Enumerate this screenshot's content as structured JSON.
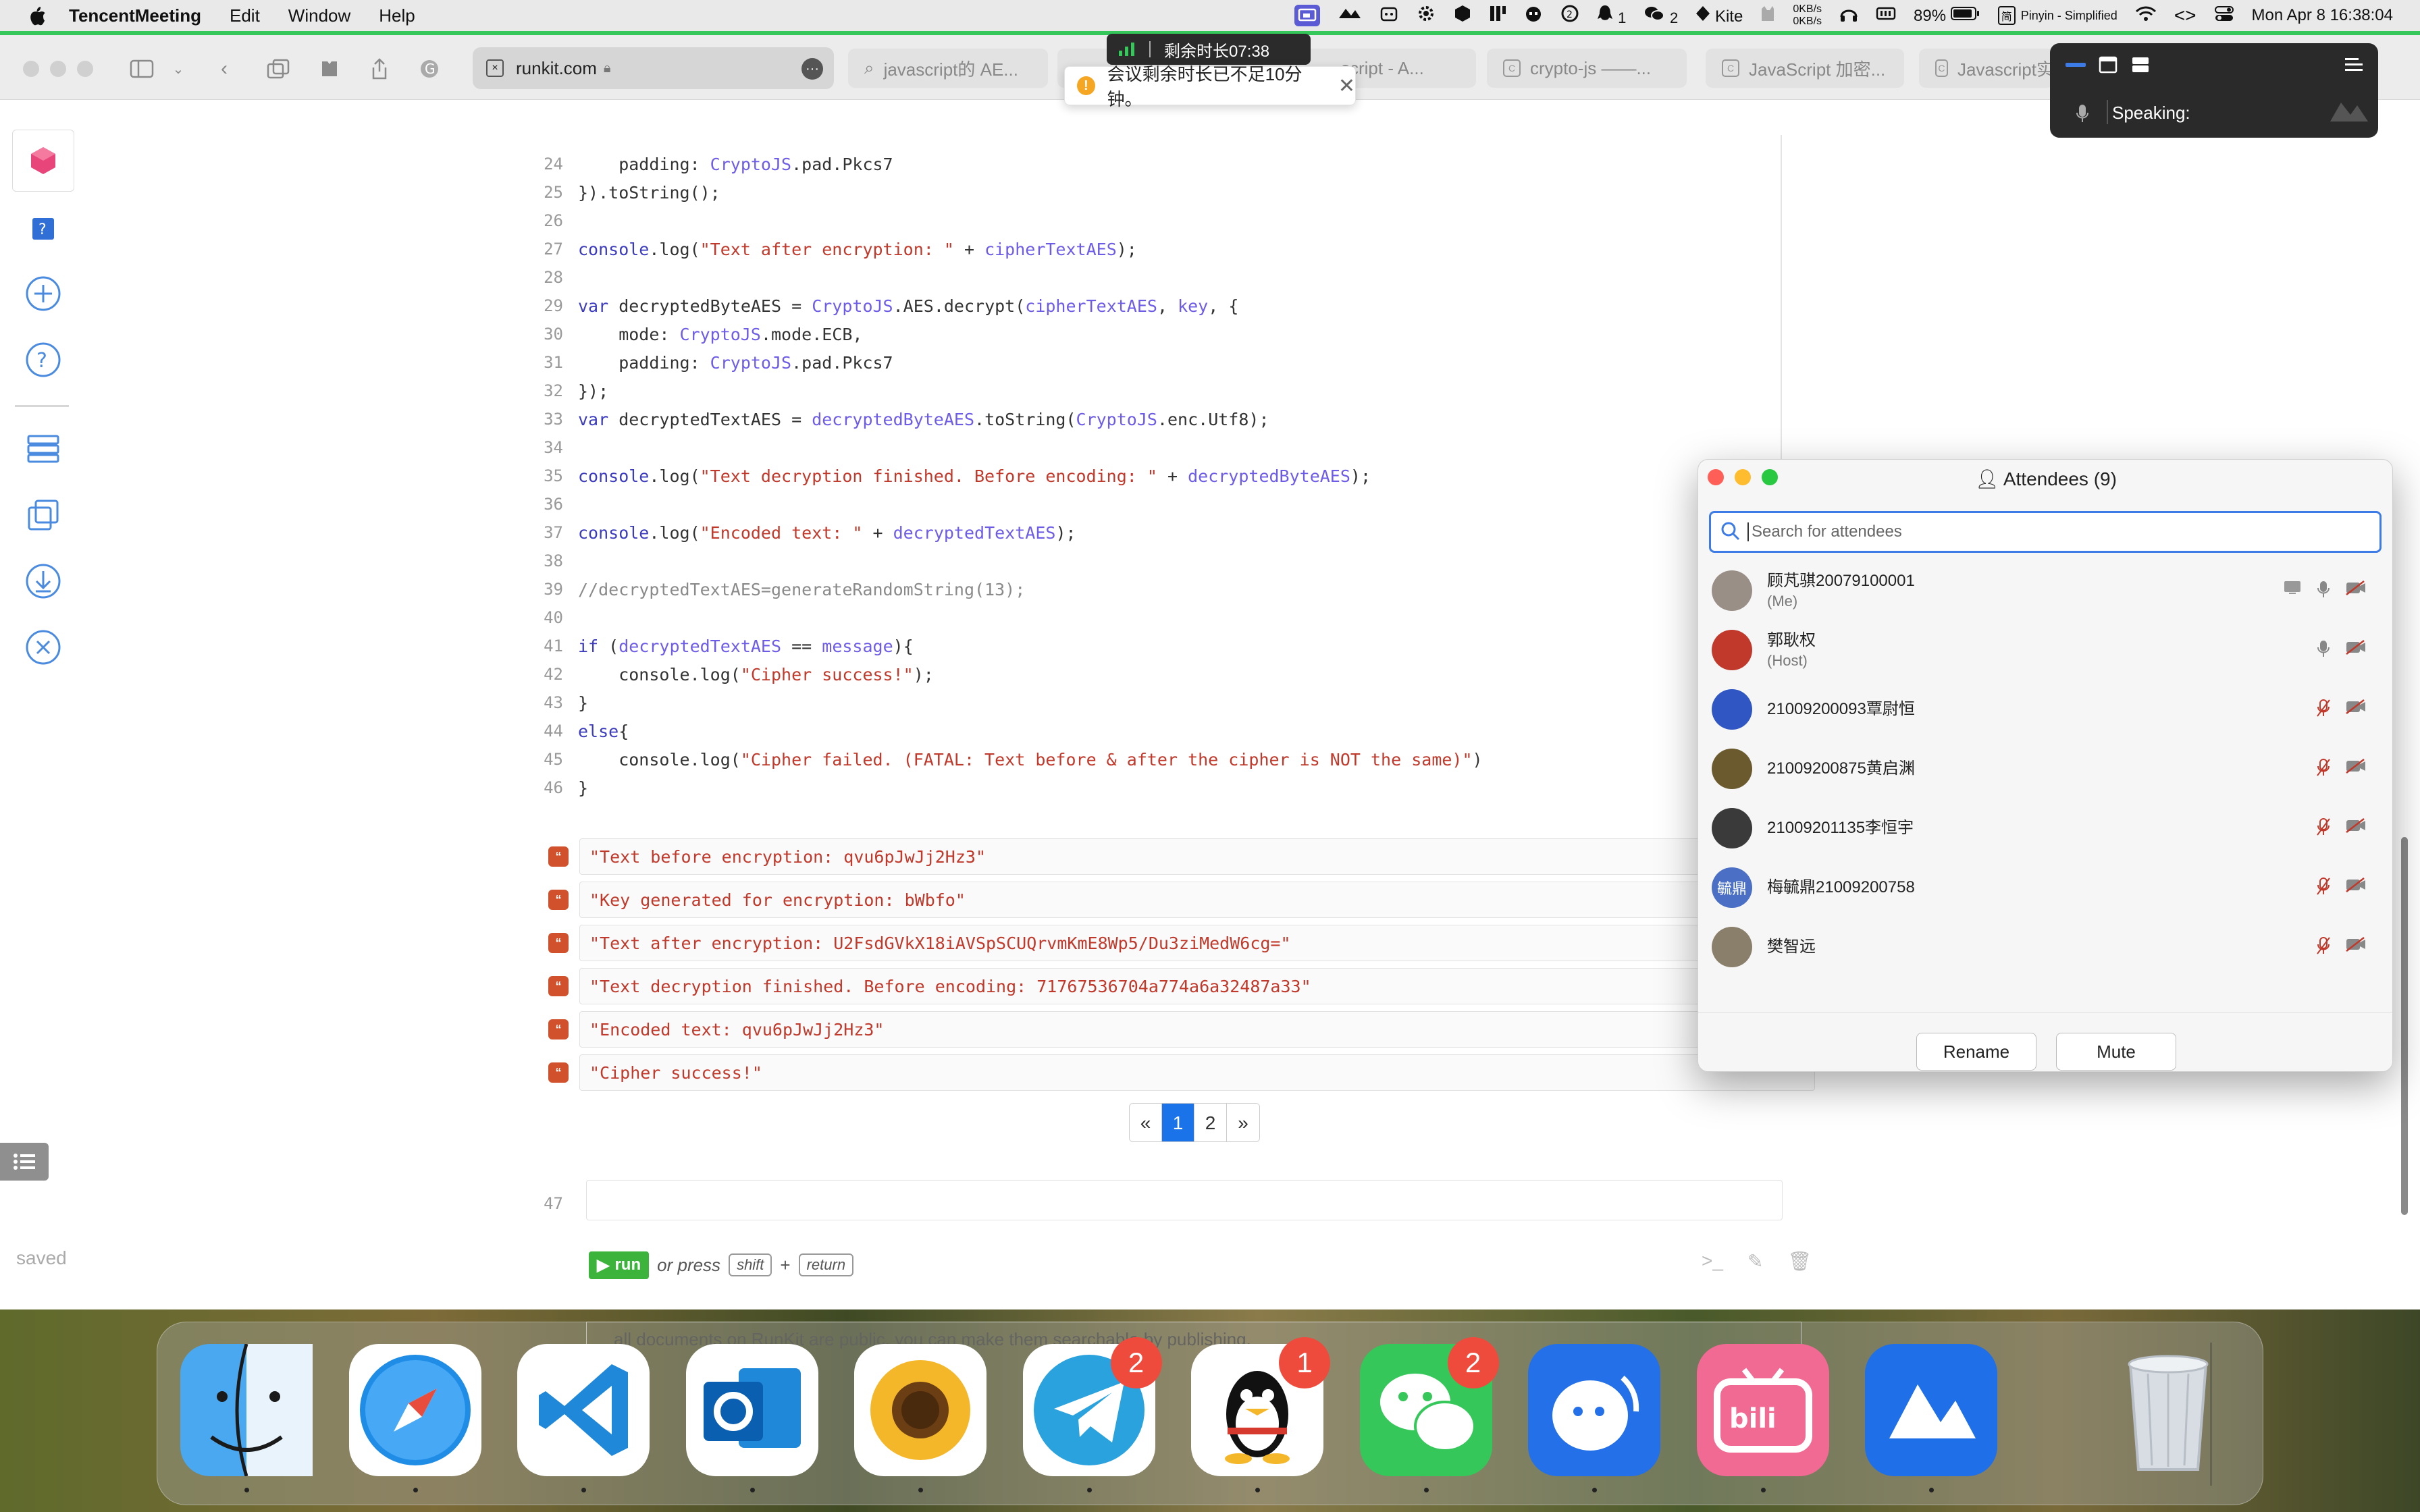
{
  "menubar": {
    "app_name": "TencentMeeting",
    "menus": [
      "Edit",
      "Window",
      "Help"
    ],
    "notif_count": "1",
    "wechat_count": "2",
    "kite_label": "Kite",
    "net_up": "0KB/s",
    "net_down": "0KB/s",
    "battery": "89%",
    "input_method": "Pinyin - Simplified",
    "datetime": "Mon Apr 8  16:38:04"
  },
  "meeting": {
    "timer_text": "剩余时长07:38",
    "warning_text": "会议剩余时长已不足10分钟。",
    "speaking_label": "Speaking:"
  },
  "browser": {
    "url": "runkit.com",
    "tabs": [
      "javascript的 AE...",
      "script - A...",
      "crypto-js ——...",
      "JavaScript 加密...",
      "Javascript实"
    ]
  },
  "code_lines": [
    {
      "n": "24",
      "t": [
        {
          "c": "ct",
          "x": "    padding: "
        },
        {
          "c": "v",
          "x": "CryptoJS"
        },
        {
          "c": "ct",
          "x": ".pad.Pkcs7"
        }
      ]
    },
    {
      "n": "25",
      "t": [
        {
          "c": "ct",
          "x": "}).toString();"
        }
      ]
    },
    {
      "n": "26",
      "t": []
    },
    {
      "n": "27",
      "t": [
        {
          "c": "k",
          "x": "console"
        },
        {
          "c": "ct",
          "x": ".log("
        },
        {
          "c": "s",
          "x": "\"Text after encryption: \""
        },
        {
          "c": "ct",
          "x": " + "
        },
        {
          "c": "v",
          "x": "cipherTextAES"
        },
        {
          "c": "ct",
          "x": ");"
        }
      ]
    },
    {
      "n": "28",
      "t": []
    },
    {
      "n": "29",
      "t": [
        {
          "c": "k",
          "x": "var"
        },
        {
          "c": "ct",
          "x": " decryptedByteAES = "
        },
        {
          "c": "v",
          "x": "CryptoJS"
        },
        {
          "c": "ct",
          "x": ".AES.decrypt("
        },
        {
          "c": "v",
          "x": "cipherTextAES"
        },
        {
          "c": "ct",
          "x": ", "
        },
        {
          "c": "v",
          "x": "key"
        },
        {
          "c": "ct",
          "x": ", {"
        }
      ]
    },
    {
      "n": "30",
      "t": [
        {
          "c": "ct",
          "x": "    mode: "
        },
        {
          "c": "v",
          "x": "CryptoJS"
        },
        {
          "c": "ct",
          "x": ".mode.ECB,"
        }
      ]
    },
    {
      "n": "31",
      "t": [
        {
          "c": "ct",
          "x": "    padding: "
        },
        {
          "c": "v",
          "x": "CryptoJS"
        },
        {
          "c": "ct",
          "x": ".pad.Pkcs7"
        }
      ]
    },
    {
      "n": "32",
      "t": [
        {
          "c": "ct",
          "x": "});"
        }
      ]
    },
    {
      "n": "33",
      "t": [
        {
          "c": "k",
          "x": "var"
        },
        {
          "c": "ct",
          "x": " decryptedTextAES = "
        },
        {
          "c": "v",
          "x": "decryptedByteAES"
        },
        {
          "c": "ct",
          "x": ".toString("
        },
        {
          "c": "v",
          "x": "CryptoJS"
        },
        {
          "c": "ct",
          "x": ".enc.Utf8);"
        }
      ]
    },
    {
      "n": "34",
      "t": []
    },
    {
      "n": "35",
      "t": [
        {
          "c": "k",
          "x": "console"
        },
        {
          "c": "ct",
          "x": ".log("
        },
        {
          "c": "s",
          "x": "\"Text decryption finished. Before encoding: \""
        },
        {
          "c": "ct",
          "x": " + "
        },
        {
          "c": "v",
          "x": "decryptedByteAES"
        },
        {
          "c": "ct",
          "x": ");"
        }
      ]
    },
    {
      "n": "36",
      "t": []
    },
    {
      "n": "37",
      "t": [
        {
          "c": "k",
          "x": "console"
        },
        {
          "c": "ct",
          "x": ".log("
        },
        {
          "c": "s",
          "x": "\"Encoded text: \""
        },
        {
          "c": "ct",
          "x": " + "
        },
        {
          "c": "v",
          "x": "decryptedTextAES"
        },
        {
          "c": "ct",
          "x": ");"
        }
      ]
    },
    {
      "n": "38",
      "t": []
    },
    {
      "n": "39",
      "t": [
        {
          "c": "cm",
          "x": "//decryptedTextAES=generateRandomString(13);"
        }
      ]
    },
    {
      "n": "40",
      "t": []
    },
    {
      "n": "41",
      "t": [
        {
          "c": "k",
          "x": "if"
        },
        {
          "c": "ct",
          "x": " ("
        },
        {
          "c": "v",
          "x": "decryptedTextAES"
        },
        {
          "c": "ct",
          "x": " == "
        },
        {
          "c": "v",
          "x": "message"
        },
        {
          "c": "ct",
          "x": "){"
        }
      ]
    },
    {
      "n": "42",
      "t": [
        {
          "c": "ct",
          "x": "    console.log("
        },
        {
          "c": "s",
          "x": "\"Cipher success!\""
        },
        {
          "c": "ct",
          "x": ");"
        }
      ]
    },
    {
      "n": "43",
      "t": [
        {
          "c": "ct",
          "x": "}"
        }
      ]
    },
    {
      "n": "44",
      "t": [
        {
          "c": "k",
          "x": "else"
        },
        {
          "c": "ct",
          "x": "{"
        }
      ]
    },
    {
      "n": "45",
      "t": [
        {
          "c": "ct",
          "x": "    console.log("
        },
        {
          "c": "s",
          "x": "\"Cipher failed. (FATAL: Text before & after the cipher is NOT the same)\""
        },
        {
          "c": "ct",
          "x": ")"
        }
      ]
    },
    {
      "n": "46",
      "t": [
        {
          "c": "ct",
          "x": "}"
        }
      ]
    }
  ],
  "outputs": [
    "\"Text before encryption: qvu6pJwJj2Hz3\"",
    "\"Key generated for encryption: bWbfo\"",
    "\"Text after encryption: U2FsdGVkX18iAVSpSCUQrvmKmE8Wp5/Du3ziMedW6cg=\"",
    "\"Text decryption finished. Before encoding: 71767536704a774a6a32487a33\"",
    "\"Encoded text: qvu6pJwJj2Hz3\"",
    "\"Cipher success!\""
  ],
  "pager": {
    "prev": "«",
    "pages": [
      "1",
      "2"
    ],
    "next": "»"
  },
  "editor": {
    "line47": "47",
    "run_label": "run",
    "or_press": "or press",
    "key_shift": "shift",
    "plus": "+",
    "key_return": "return",
    "notice": "all documents on RunKit are public. you can make them searchable by publishing.",
    "saved": "saved"
  },
  "attendees": {
    "title": "Attendees (9)",
    "search_placeholder": "Search for attendees",
    "list": [
      {
        "name": "顾芃骐20079100001",
        "sub": "(Me)",
        "avatar_text": "",
        "avatar_color": "#9a8f86",
        "screen": true,
        "mic_muted": false
      },
      {
        "name": "郭耿权",
        "sub": "(Host)",
        "avatar_text": "",
        "avatar_color": "#c0392b",
        "screen": false,
        "mic_muted": false
      },
      {
        "name": "21009200093覃尉恒",
        "sub": "",
        "avatar_text": "",
        "avatar_color": "#2f56c2",
        "screen": false,
        "mic_muted": true
      },
      {
        "name": "21009200875黄启渊",
        "sub": "",
        "avatar_text": "",
        "avatar_color": "#6b5a2e",
        "screen": false,
        "mic_muted": true
      },
      {
        "name": "21009201135李恒宇",
        "sub": "",
        "avatar_text": "",
        "avatar_color": "#3a3a3a",
        "screen": false,
        "mic_muted": true
      },
      {
        "name": "梅毓鼎21009200758",
        "sub": "",
        "avatar_text": "毓鼎",
        "avatar_color": "#4a6fc4",
        "screen": false,
        "mic_muted": true
      },
      {
        "name": "樊智远",
        "sub": "",
        "avatar_text": "",
        "avatar_color": "#8a7f6a",
        "screen": false,
        "mic_muted": true
      }
    ],
    "rename_label": "Rename",
    "mute_label": "Mute"
  },
  "dock": {
    "apps": [
      {
        "name": "finder",
        "badge": ""
      },
      {
        "name": "safari",
        "badge": ""
      },
      {
        "name": "vscode",
        "badge": ""
      },
      {
        "name": "outlook",
        "badge": ""
      },
      {
        "name": "sunflower",
        "badge": ""
      },
      {
        "name": "telegram",
        "badge": "2"
      },
      {
        "name": "qq",
        "badge": "1"
      },
      {
        "name": "wechat",
        "badge": "2"
      },
      {
        "name": "tencent-chat",
        "badge": ""
      },
      {
        "name": "bilibili",
        "badge": ""
      },
      {
        "name": "tencent-meeting",
        "badge": ""
      }
    ]
  },
  "colors": {
    "accent": "#1a73e8",
    "green": "#35c759",
    "run": "#3cb43c",
    "badge": "#ee4b3d"
  }
}
